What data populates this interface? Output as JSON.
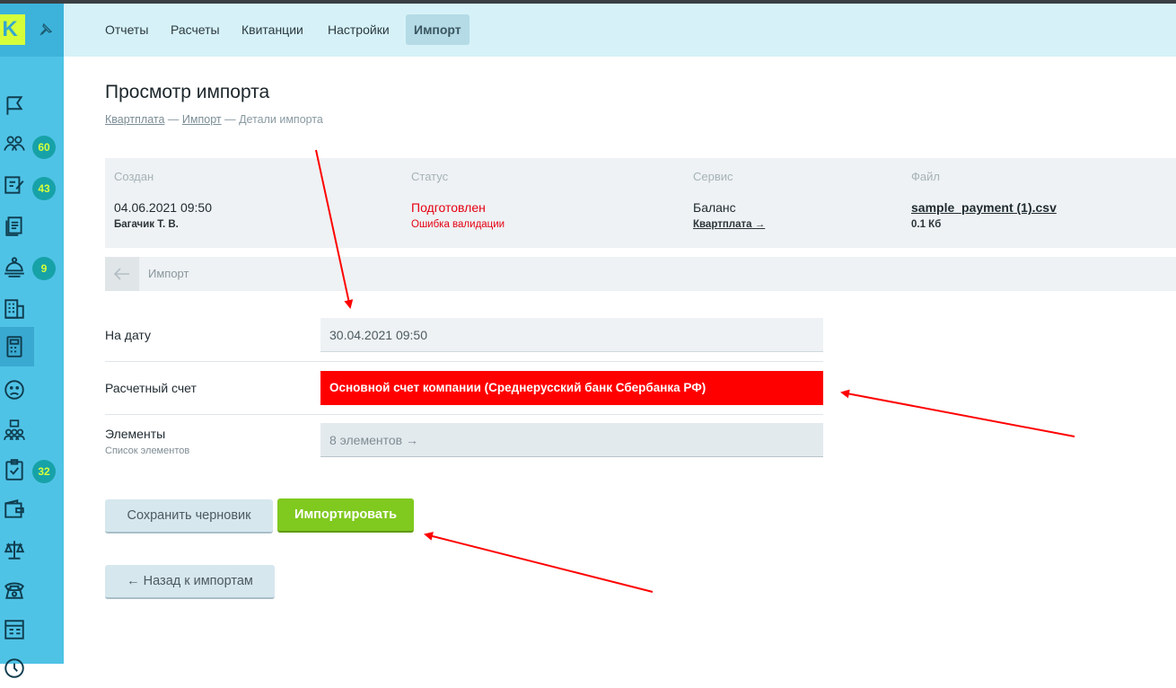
{
  "logo": {
    "letter": "K"
  },
  "sidebar": {
    "badges": [
      "60",
      "43",
      "9",
      "32"
    ]
  },
  "topnav": {
    "tabs": [
      "Отчеты",
      "Расчеты",
      "Квитанции",
      "Настройки",
      "Импорт"
    ],
    "active": "Импорт"
  },
  "page": {
    "title": "Просмотр импорта",
    "breadcrumb": {
      "items": [
        "Квартплата",
        "Импорт",
        "Детали импорта"
      ],
      "separator": "—"
    }
  },
  "info": {
    "created": {
      "label": "Создан",
      "value": "04.06.2021 09:50",
      "sub": "Багачик Т. В."
    },
    "status": {
      "label": "Статус",
      "value": "Подготовлен",
      "sub": "Ошибка валидации"
    },
    "service": {
      "label": "Сервис",
      "value": "Баланс",
      "sub": "Квартплата →"
    },
    "file": {
      "label": "Файл",
      "value": "sample_payment (1).csv",
      "sub": "0.1 Кб"
    }
  },
  "import_row": {
    "label": "Импорт"
  },
  "form": {
    "date": {
      "label": "На дату",
      "value": "30.04.2021 09:50"
    },
    "account": {
      "label": "Расчетный счет",
      "value": "Основной счет компании (Среднерусский банк Сбербанка РФ)"
    },
    "elements": {
      "label": "Элементы",
      "sublabel": "Список элементов",
      "value": "8 элементов →"
    }
  },
  "buttons": {
    "save_draft": "Сохранить черновик",
    "import": "Импортировать",
    "back": "← Назад к импортам"
  },
  "colors": {
    "sidebar": "#4fc3e6",
    "topbar": "#d6f2f8",
    "accent_green": "#80c91f",
    "error_red": "#e60012",
    "annotation_red": "#ff0000"
  }
}
